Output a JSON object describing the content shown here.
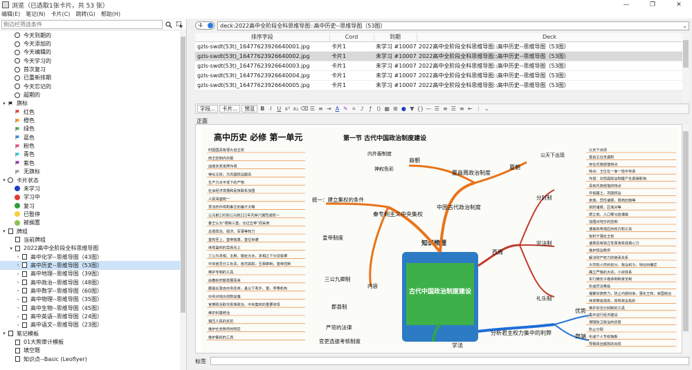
{
  "window": {
    "title": "浏览（已选取1张卡片，共 53 张）",
    "controls": [
      "—",
      "❐",
      "✕"
    ]
  },
  "menu": [
    "编辑(E)",
    "笔记(N)",
    "卡片(C)",
    "跳转(G)",
    "帮助(H)"
  ],
  "sidebar": {
    "filter_placeholder": "侧边栏筛选条件",
    "items": [
      {
        "label": "今天到期的",
        "icon": "clock-icon",
        "depth": 1
      },
      {
        "label": "今天添加的",
        "icon": "clock-icon",
        "depth": 1
      },
      {
        "label": "今天编辑的",
        "icon": "clock-icon",
        "depth": 1
      },
      {
        "label": "今天学习的",
        "icon": "clock-icon",
        "depth": 1
      },
      {
        "label": "首次复习",
        "icon": "clock-icon",
        "depth": 1
      },
      {
        "label": "已重新排期",
        "icon": "clock-icon",
        "depth": 1
      },
      {
        "label": "今天忘记的",
        "icon": "clock-icon",
        "depth": 1
      },
      {
        "label": "超期的",
        "icon": "clock-icon",
        "depth": 1
      },
      {
        "label": "旗标",
        "icon": "flag-icon",
        "depth": 0,
        "color": "#222222"
      },
      {
        "label": "红色",
        "icon": "flag-icon",
        "depth": 1,
        "color": "#e53935"
      },
      {
        "label": "橙色",
        "icon": "flag-icon",
        "depth": 1,
        "color": "#fb8c00"
      },
      {
        "label": "绿色",
        "icon": "flag-icon",
        "depth": 1,
        "color": "#43a047"
      },
      {
        "label": "蓝色",
        "icon": "flag-icon",
        "depth": 1,
        "color": "#1e88e5"
      },
      {
        "label": "粉色",
        "icon": "flag-icon",
        "depth": 1,
        "color": "#ec407a"
      },
      {
        "label": "青色",
        "icon": "flag-icon",
        "depth": 1,
        "color": "#26c6da"
      },
      {
        "label": "紫色",
        "icon": "flag-icon",
        "depth": 1,
        "color": "#8e24aa"
      },
      {
        "label": "无旗标",
        "icon": "flag-icon",
        "depth": 1,
        "color": "#9e9e9e"
      },
      {
        "label": "卡片状态",
        "icon": "circle-icon",
        "depth": 0,
        "color": "#ffffff"
      },
      {
        "label": "未学习",
        "icon": "dot-icon",
        "depth": 1,
        "color": "#1e40c8"
      },
      {
        "label": "学习中",
        "icon": "dot-icon",
        "depth": 1,
        "color": "#e53935"
      },
      {
        "label": "复习",
        "icon": "dot-icon",
        "depth": 1,
        "color": "#2e9e3e"
      },
      {
        "label": "已暂停",
        "icon": "dot-icon",
        "depth": 1,
        "color": "#f4d03f"
      },
      {
        "label": "被搁置",
        "icon": "dot-icon",
        "depth": 1,
        "color": "#8bc34a"
      },
      {
        "label": "牌组",
        "icon": "deck-icon",
        "depth": 0
      },
      {
        "label": "当前牌组",
        "icon": "deck-icon",
        "depth": 1
      },
      {
        "label": "2022高中全阶段全科思维导图",
        "icon": "deck-icon",
        "depth": 1
      },
      {
        "label": "高中化学--思维导图（43图）",
        "icon": "deck-icon",
        "depth": 2
      },
      {
        "label": "高中历史--思维导图（53图）",
        "icon": "deck-icon",
        "depth": 2,
        "selected": true
      },
      {
        "label": "高中地理--思维导图（39图）",
        "icon": "deck-icon",
        "depth": 2
      },
      {
        "label": "高中政治--思维导图（48图）",
        "icon": "deck-icon",
        "depth": 2
      },
      {
        "label": "高中数学--思维导图（60图）",
        "icon": "deck-icon",
        "depth": 2
      },
      {
        "label": "高中物理--思维导图（35图）",
        "icon": "deck-icon",
        "depth": 2
      },
      {
        "label": "高中生物--思维导图（45图）",
        "icon": "deck-icon",
        "depth": 2
      },
      {
        "label": "高中英语--思维导图（24图）",
        "icon": "deck-icon",
        "depth": 2
      },
      {
        "label": "高中语文--思维导图（23图）",
        "icon": "deck-icon",
        "depth": 2
      },
      {
        "label": "笔记模板",
        "icon": "deck-icon",
        "depth": 0
      },
      {
        "label": "01大熊审计模板",
        "icon": "deck-icon",
        "depth": 1
      },
      {
        "label": "填空题",
        "icon": "deck-icon",
        "depth": 1
      },
      {
        "label": "知识点--Basic (Leoflyer)",
        "icon": "deck-icon",
        "depth": 1
      }
    ]
  },
  "search": {
    "toggle_label": "卡",
    "query": "deck:2022高中全阶段全科思维导图::高中历史--思维导图（53图）"
  },
  "table": {
    "columns": [
      "排序字段",
      "Cord",
      "到期",
      "Deck"
    ],
    "rows": [
      [
        "gzls-swdt(53t)_1647762392664000​1.jpg",
        "卡片1",
        "未学习 #1000745",
        "2022高中全阶段全科思维导图::高中历史--思维导图（53图）"
      ],
      [
        "gzls-swdt(53t)_1647762392664000​2.jpg",
        "卡片1",
        "未学习 #1000746",
        "2022高中全阶段全科思维导图::高中历史--思维导图（53图）"
      ],
      [
        "gzls-swdt(53t)_1647762392664000​3.jpg",
        "卡片1",
        "未学习 #1000747",
        "2022高中全阶段全科思维导图::高中历史--思维导图（53图）"
      ],
      [
        "gzls-swdt(53t)_1647762392664000​4.jpg",
        "卡片1",
        "未学习 #1000748",
        "2022高中全阶段全科思维导图::高中历史--思维导图（53图）"
      ],
      [
        "gzls-swdt(53t)_1647762392664000​5.jpg",
        "卡片1",
        "未学习 #1000749",
        "2022高中全阶段全科思维导图::高中历史--思维导图（53图）"
      ]
    ],
    "selected_row": 1
  },
  "editor_toolbar": {
    "fields_button": "字段...",
    "cards_button": "卡片...",
    "preview_button": "预览"
  },
  "editor": {
    "field_label": "正面",
    "tags_label": "标签",
    "image": {
      "heading": "高中历史  必修  第一单元",
      "section": "第一节  古代中国政治制度建设",
      "center_title": "古代中国政治制度建设",
      "center_sub": "知识梳理",
      "nodes": {
        "shangzhou": "夏商周政治制度",
        "qinhan": "秦专制主义中央集权",
        "zhongguo": "中国古代政治制度",
        "xizhou": "西周",
        "xiachao": "夏朝",
        "shangchao": "商朝",
        "tongyi": "统一：建立集权的条件",
        "huangdi": "皇帝制度",
        "sangong": "三公九卿制",
        "junxian": "郡县制",
        "neirong": "内容",
        "yange": "严苛的法律",
        "kaohe": "官吏选拔考核制度",
        "fenxi": "分析君主权力集中的利弊",
        "youshi": "优势",
        "bibing": "弊端",
        "xuefa": "学法",
        "fenfeng": "分封制",
        "zongfa": "宗法制",
        "lizhi": "礼乐制",
        "neifu": "内外服制度",
        "shenquan": "神权色彩",
        "shijia": "世袭制出现",
        "gongtian": "公天下出现"
      },
      "leaves_left": [
        "时困国具有很大自主权",
        "商王控制内外服",
        "血缘关系发挥作用",
        "神化王权，为巩固统治服务",
        "生产力水平低下的产物",
        "社会经济发展和民族联系加强",
        "人民渴望统一",
        "变法的作用和秦王的雄才大略",
        "公元前230到公元前221年灭掉六国完成统一",
        "秦王认为“德高三皇，功过五帝”而采用",
        "总揽政治、经济、军事等权力",
        "皇权至上、皇帝独尊、皇位世袭",
        "体现皇权的至高无上",
        "三公为丞相、太尉、御史大夫，丞相之下分设各卿",
        "中央官员分工负责，各司其职，互相牵制，皇帝控制",
        "维护专制的工具",
        "由春秋时期发展而来",
        "郡县长官由中央任命，县以下有乡、里，亭等机构",
        "中央对地方控制加强",
        "官僚政治取代贵族政治，中央集权的重要体现",
        "维护封建统治",
        "镇压人民的反抗",
        "维护社会秩序的制定",
        "维护集权的工具"
      ],
      "leaves_right": [
        "公天下出现",
        "首创王位世袭制",
        "存在氏族部落特点",
        "特点：王位在一家一姓中传承",
        "作用：对西周政治制度产生直接影响",
        "具有氏族部落的特点",
        "开拓疆土，巩固统治",
        "亲族，异性诸侯，周商旧族等",
        "依附诸侯，区域对等",
        "把土地、人口等分给诸侯",
        "加强对地方的控制",
        "诸侯具有相应的权力和义务",
        "有利于强化王权",
        "诸侯具有独立性易演变成离心力",
        "维护统治秩序",
        "解决财产权力的继承关系",
        "大宗和小宗的划分，政治权力、地位的确定",
        "确立严格的大宗，小宗体系",
        "实行嫡长子继承制和家长制",
        "形成宗法等级",
        "凝聚宗族势力，防止内部纷争，强化王权，家国结合",
        "体现等级观念，具有政治色彩",
        "维护宗法分封制的工具",
        "集中进行经济建设",
        "保障防卫政治的优势",
        "防止分裂",
        "形成个人专权独断",
        "导致政治腐败的出现"
      ],
      "labels_mid": [
        "原因",
        "过程",
        "由来",
        "皇帝的权力",
        "特点",
        "影响",
        "构成",
        "特点",
        "性质",
        "由来",
        "内容",
        "意义",
        "特点",
        "作用",
        "目的",
        "分封对象",
        "内容",
        "作用和影响",
        "分封制",
        "目的",
        "性质",
        "内容",
        "作用",
        "内外服制度",
        "神权色彩",
        "作用"
      ]
    }
  },
  "colors": {
    "accent_blue": "#2a7de1",
    "selection": "#cde3f7",
    "map_orange": "#e8731a",
    "map_red": "#c0392b",
    "map_blue": "#1e6fd9"
  }
}
